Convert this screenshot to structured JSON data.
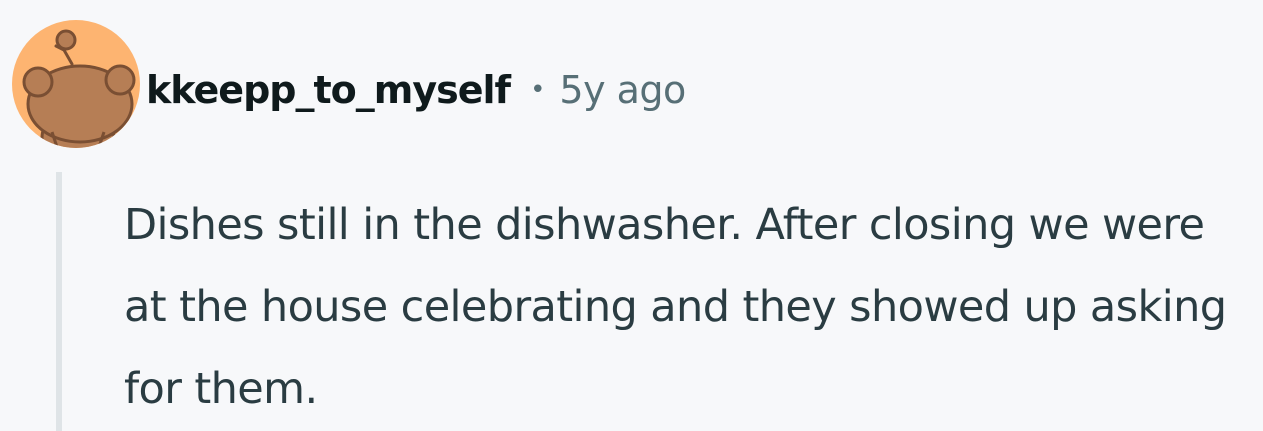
{
  "comment": {
    "author": "kkeepp_to_myself",
    "separator": "•",
    "timestamp": "5y ago",
    "body": "Dishes still in the dishwasher. After closing we were at the house celebrating and they showed up asking for them."
  },
  "avatar": {
    "icon": "snoo-avatar-icon",
    "background_color": "#fdb471",
    "figure_color": "#b67e55"
  },
  "colors": {
    "background": "#f7f8fa",
    "username": "#0f1a1c",
    "meta": "#576f76",
    "body_text": "#2a3c42",
    "thread_line": "#dfe4e7"
  }
}
